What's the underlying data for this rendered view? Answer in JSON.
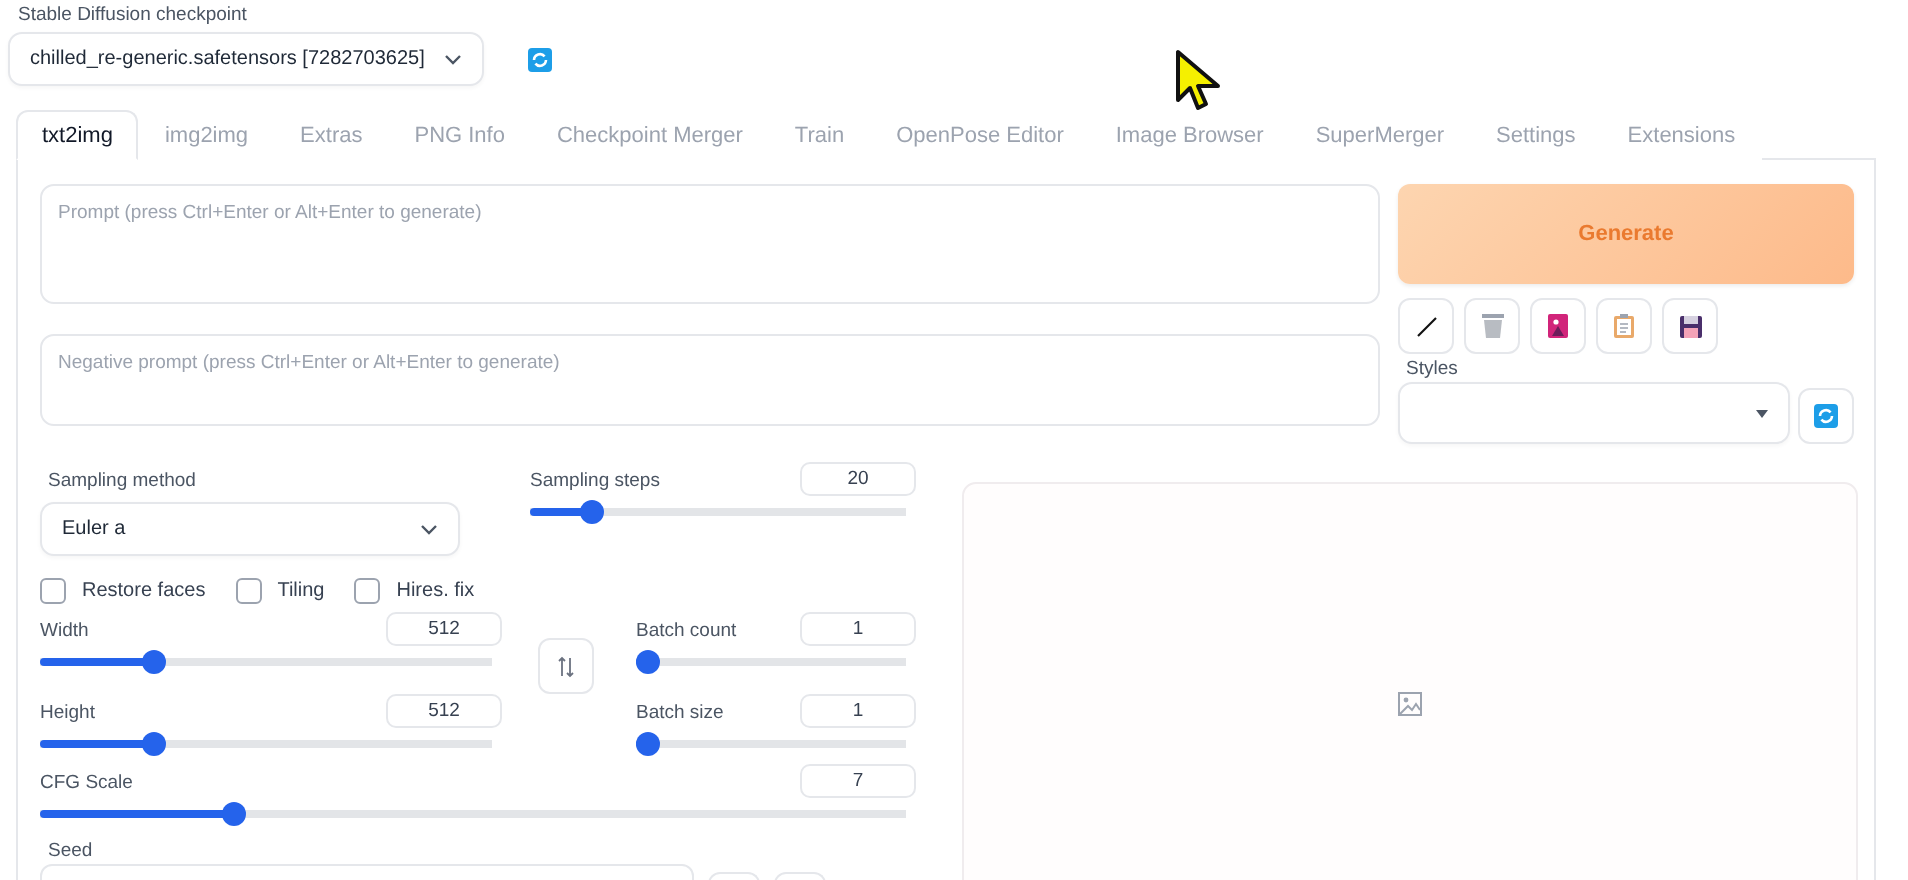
{
  "checkpoint": {
    "label": "Stable Diffusion checkpoint",
    "value": "chilled_re-generic.safetensors [7282703625]"
  },
  "tabs": [
    {
      "label": "txt2img",
      "selected": true
    },
    {
      "label": "img2img",
      "selected": false
    },
    {
      "label": "Extras",
      "selected": false
    },
    {
      "label": "PNG Info",
      "selected": false
    },
    {
      "label": "Checkpoint Merger",
      "selected": false
    },
    {
      "label": "Train",
      "selected": false
    },
    {
      "label": "OpenPose Editor",
      "selected": false
    },
    {
      "label": "Image Browser",
      "selected": false
    },
    {
      "label": "SuperMerger",
      "selected": false
    },
    {
      "label": "Settings",
      "selected": false
    },
    {
      "label": "Extensions",
      "selected": false
    }
  ],
  "prompt": {
    "placeholder": "Prompt (press Ctrl+Enter or Alt+Enter to generate)"
  },
  "negative_prompt": {
    "placeholder": "Negative prompt (press Ctrl+Enter or Alt+Enter to generate)"
  },
  "generate_button": "Generate",
  "tool_buttons": [
    {
      "kind": "pencil"
    },
    {
      "kind": "trash"
    },
    {
      "kind": "book"
    },
    {
      "kind": "clipboard"
    },
    {
      "kind": "save"
    }
  ],
  "styles": {
    "label": "Styles"
  },
  "sampling_method": {
    "label": "Sampling method",
    "value": "Euler a"
  },
  "sampling_steps": {
    "label": "Sampling steps",
    "value": "20",
    "level": 0.14
  },
  "checkboxes": [
    {
      "label": "Restore faces",
      "checked": false
    },
    {
      "label": "Tiling",
      "checked": false
    },
    {
      "label": "Hires. fix",
      "checked": false
    }
  ],
  "width": {
    "label": "Width",
    "value": "512",
    "level": 0.24
  },
  "height": {
    "label": "Height",
    "value": "512",
    "level": 0.24
  },
  "batch_count": {
    "label": "Batch count",
    "value": "1",
    "level": 0
  },
  "batch_size": {
    "label": "Batch size",
    "value": "1",
    "level": 0
  },
  "cfg_scale": {
    "label": "CFG Scale",
    "value": "7",
    "level": 0.215
  },
  "seed": {
    "label": "Seed"
  }
}
